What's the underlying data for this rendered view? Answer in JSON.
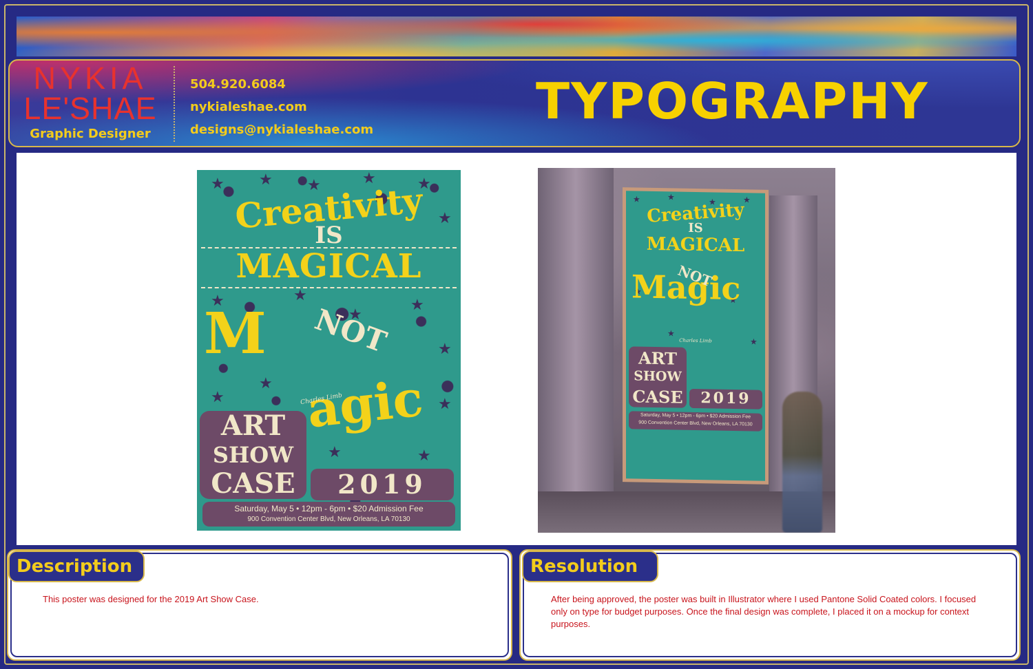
{
  "brand": {
    "name_line1": "NYKIA",
    "name_line2": "LE'SHAE",
    "subtitle": "Graphic Designer"
  },
  "contact": {
    "phone": "504.920.6084",
    "website": "nykialeshae.com",
    "email": "designs@nykialeshae.com"
  },
  "page_title": "TYPOGRAPHY",
  "poster": {
    "line1": "Creativity",
    "line2": "IS",
    "line3": "MAGICAL",
    "line4": "M",
    "line5": "NOT",
    "line6": "agic",
    "quote": "Charles Limb",
    "art": "ART",
    "show": "SHOW",
    "case": "CASE",
    "year": "2019",
    "info1": "Saturday, May 5  •  12pm - 6pm  •  $20 Admission Fee",
    "info2": "900 Convention Center Blvd, New Orleans, LA 70130"
  },
  "mockup": {
    "line1": "Creativity",
    "line2": "IS",
    "line3": "MAGICAL",
    "line4": "Magic",
    "line5": "NOT",
    "art": "ART",
    "show": "SHOW",
    "case": "CASE",
    "year": "2019",
    "quote": "Charles Limb",
    "info1": "Saturday, May 5 • 12pm - 6pm • $20 Admission Fee",
    "info2": "900 Convention Center Blvd, New Orleans, LA 70130"
  },
  "description": {
    "label": "Description",
    "text": "This poster was designed for the 2019 Art Show Case."
  },
  "resolution": {
    "label": "Resolution",
    "text": "After being approved, the poster was built in Illustrator where I used Pantone Solid Coated colors. I focused only on type for budget purposes. Once the final design was complete, I placed it on a mockup for context purposes."
  },
  "colors": {
    "background": "#262a84",
    "accent_yellow": "#f3cc1c",
    "brand_red": "#e8322e",
    "poster_teal": "#2f9a8c",
    "poster_plum": "#6d4a67",
    "body_red": "#c8141c"
  }
}
